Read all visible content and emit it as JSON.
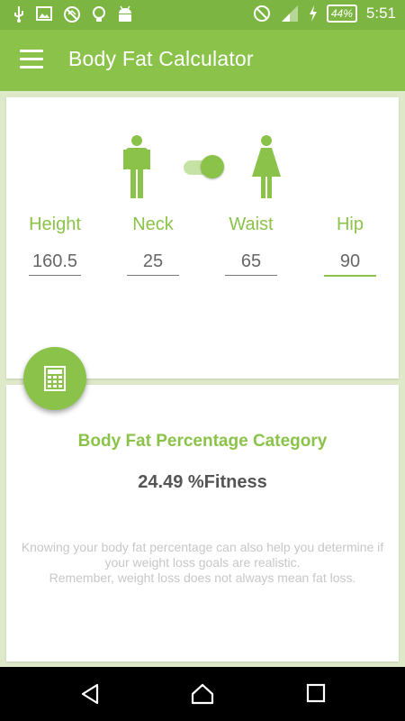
{
  "status_bar": {
    "icons": [
      "usb-icon",
      "image-icon",
      "no-sync-icon",
      "lightbulb-icon",
      "android-icon",
      "do-not-disturb-icon",
      "signal-icon",
      "charging-icon"
    ],
    "battery": "44%",
    "time": "5:51"
  },
  "app_bar": {
    "title": "Body Fat Calculator",
    "menu_icon": "hamburger-menu-icon"
  },
  "gender": {
    "male_icon": "male-figure-icon",
    "female_icon": "female-figure-icon",
    "selected": "female"
  },
  "fields": [
    {
      "label": "Height",
      "value": "160.5"
    },
    {
      "label": "Neck",
      "value": "25"
    },
    {
      "label": "Waist",
      "value": "65"
    },
    {
      "label": "Hip",
      "value": "90"
    }
  ],
  "calculate_icon": "calculator-icon",
  "result": {
    "category_title": "Body Fat Percentage Category",
    "value": "24.49 %Fitness",
    "note_line1": "Knowing your body fat percentage can also help you determine if",
    "note_line2": "your weight loss goals are realistic.",
    "note_line3": "Remember, weight loss does not always mean fat loss."
  },
  "colors": {
    "accent": "#8bc34a",
    "status_bar": "#7cb542",
    "background": "#dde9c9"
  },
  "nav_bar": {
    "back_icon": "back-triangle-icon",
    "home_icon": "home-icon",
    "recents_icon": "recents-square-icon"
  }
}
